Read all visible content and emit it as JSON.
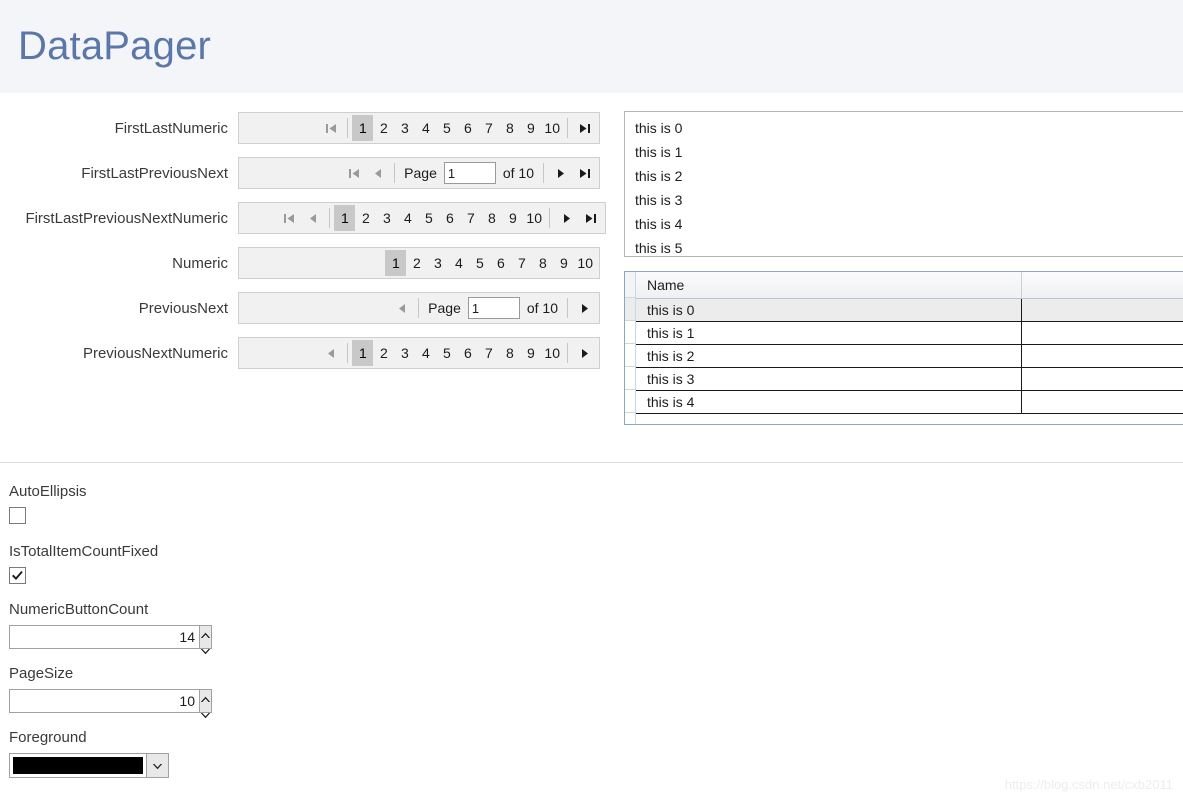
{
  "header": {
    "title": "DataPager"
  },
  "pagers": [
    {
      "label": "FirstLastNumeric",
      "buttons": [
        "first"
      ],
      "numbers": [
        "1",
        "2",
        "3",
        "4",
        "5",
        "6",
        "7",
        "8",
        "9",
        "10"
      ],
      "selected": "1",
      "tail": [
        "last"
      ]
    },
    {
      "label": "FirstLastPreviousNext",
      "buttons": [
        "first",
        "previous"
      ],
      "page_label": "Page",
      "page_value": "1",
      "of_label": "of 10",
      "tail": [
        "next",
        "last"
      ]
    },
    {
      "label": "FirstLastPreviousNextNumeric",
      "buttons": [
        "first",
        "previous"
      ],
      "numbers": [
        "1",
        "2",
        "3",
        "4",
        "5",
        "6",
        "7",
        "8",
        "9",
        "10"
      ],
      "selected": "1",
      "tail": [
        "next",
        "last"
      ]
    },
    {
      "label": "Numeric",
      "buttons": [],
      "numbers": [
        "1",
        "2",
        "3",
        "4",
        "5",
        "6",
        "7",
        "8",
        "9",
        "10"
      ],
      "selected": "1",
      "tail": []
    },
    {
      "label": "PreviousNext",
      "buttons": [
        "previous"
      ],
      "page_label": "Page",
      "page_value": "1",
      "of_label": "of 10",
      "tail": [
        "next"
      ]
    },
    {
      "label": "PreviousNextNumeric",
      "buttons": [
        "previous"
      ],
      "numbers": [
        "1",
        "2",
        "3",
        "4",
        "5",
        "6",
        "7",
        "8",
        "9",
        "10"
      ],
      "selected": "1",
      "tail": [
        "next"
      ]
    }
  ],
  "listbox": {
    "items": [
      "this is 0",
      "this is 1",
      "this is 2",
      "this is 3",
      "this is 4",
      "this is 5"
    ]
  },
  "datagrid": {
    "columns": [
      "Name",
      ""
    ],
    "rows": [
      {
        "name": "this is 0",
        "selected": true
      },
      {
        "name": "this is 1",
        "selected": false
      },
      {
        "name": "this is 2",
        "selected": false
      },
      {
        "name": "this is 3",
        "selected": false
      },
      {
        "name": "this is 4",
        "selected": false
      }
    ]
  },
  "properties": {
    "auto_ellipsis": {
      "label": "AutoEllipsis",
      "checked": false
    },
    "is_total_item_count_fixed": {
      "label": "IsTotalItemCountFixed",
      "checked": true
    },
    "numeric_button_count": {
      "label": "NumericButtonCount",
      "value": "14"
    },
    "page_size": {
      "label": "PageSize",
      "value": "10"
    },
    "foreground": {
      "label": "Foreground",
      "color": "#000000"
    }
  },
  "watermark": {
    "text": "https://blog.csdn.net/cxb2011"
  },
  "icons": {
    "first": "first-page-icon",
    "previous": "previous-page-icon",
    "next": "next-page-icon",
    "last": "last-page-icon",
    "spinner_up": "chevron-up-icon",
    "spinner_down": "chevron-down-icon",
    "combo": "chevron-down-icon",
    "check": "check-icon"
  },
  "colors": {
    "header_bg": "#f4f5f9",
    "title": "#5b76a8",
    "pager_bg": "#f1f1f1",
    "selected_page_bg": "#c8c8c8"
  }
}
